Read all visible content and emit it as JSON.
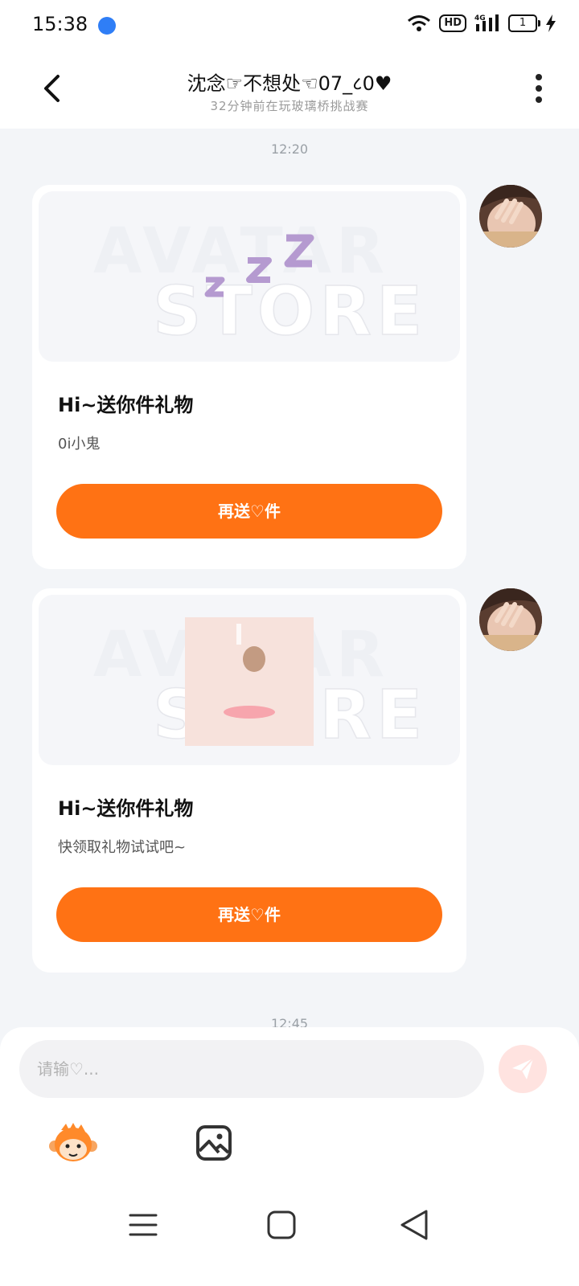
{
  "status_bar": {
    "time": "15:38",
    "hd_label": "HD",
    "network_label": "4G",
    "battery_label": "1"
  },
  "header": {
    "title": "沈念☞不想处☜07_८0♥",
    "subtitle": "32分钟前在玩玻璃桥挑战赛"
  },
  "messages": {
    "timestamp_1": "12:20",
    "timestamp_2": "12:45",
    "watermark_line1": "AVATAR",
    "watermark_line2": "STORE",
    "cards": [
      {
        "title": "Hi~送你件礼物",
        "description": "0i小鬼",
        "button_label": "再送♡件"
      },
      {
        "title": "Hi~送你件礼物",
        "description": "快领取礼物试试吧~",
        "button_label": "再送♡件"
      }
    ]
  },
  "composer": {
    "placeholder": "请输♡...",
    "value": ""
  },
  "colors": {
    "accent": "#ff7214",
    "send_button_bg": "#ffe3e0",
    "page_bg": "#f3f5f8"
  },
  "icons": {
    "back": "chevron-left-icon",
    "more": "more-vertical-icon",
    "send": "send-icon",
    "emoji": "monkey-emoji-icon",
    "image": "image-icon",
    "nav_menu": "menu-icon",
    "nav_home": "home-square-icon",
    "nav_back": "triangle-back-icon"
  }
}
